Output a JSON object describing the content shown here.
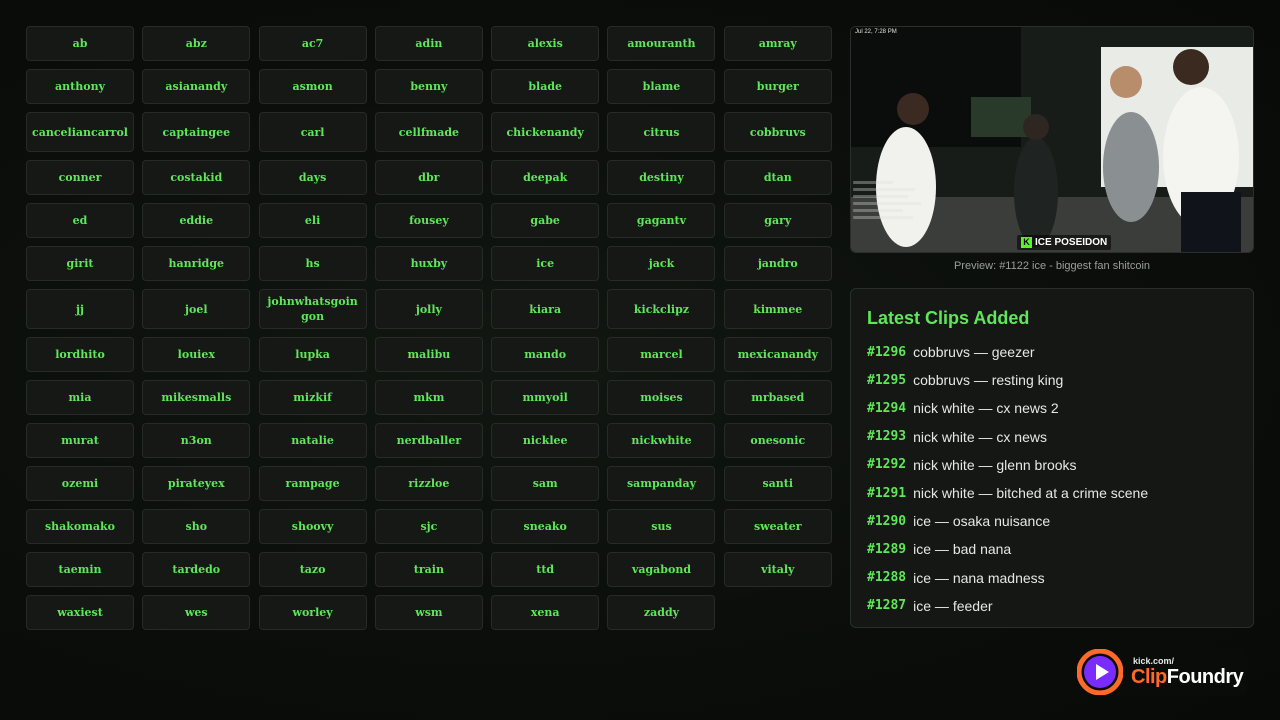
{
  "streamers": [
    "ab",
    "abz",
    "ac7",
    "adin",
    "alexis",
    "amouranth",
    "amray",
    "anthony",
    "asianandy",
    "asmon",
    "benny",
    "blade",
    "blame",
    "burger",
    "canceliancarrol",
    "captaingee",
    "carl",
    "cellfmade",
    "chickenandy",
    "citrus",
    "cobbruvs",
    "conner",
    "costakid",
    "days",
    "dbr",
    "deepak",
    "destiny",
    "dtan",
    "ed",
    "eddie",
    "eli",
    "fousey",
    "gabe",
    "gagantv",
    "gary",
    "girit",
    "hanridge",
    "hs",
    "huxby",
    "ice",
    "jack",
    "jandro",
    "jj",
    "joel",
    "johnwhatsgoingon",
    "jolly",
    "kiara",
    "kickclipz",
    "kimmee",
    "lordhito",
    "louiex",
    "lupka",
    "malibu",
    "mando",
    "marcel",
    "mexicanandy",
    "mia",
    "mikesmalls",
    "mizkif",
    "mkm",
    "mmyoil",
    "moises",
    "mrbased",
    "murat",
    "n3on",
    "natalie",
    "nerdballer",
    "nicklee",
    "nickwhite",
    "onesonic",
    "ozemi",
    "pirateyex",
    "rampage",
    "rizzloe",
    "sam",
    "sampanday",
    "santi",
    "shakomako",
    "sho",
    "shoovy",
    "sjc",
    "sneako",
    "sus",
    "sweater",
    "taemin",
    "tardedo",
    "tazo",
    "train",
    "ttd",
    "vagabond",
    "vitaly",
    "waxiest",
    "wes",
    "worley",
    "wsm",
    "xena",
    "zaddy"
  ],
  "preview": {
    "caption": "Preview: #1122 ice - biggest fan shitcoin",
    "timestamp": "Jul 22, 7:28 PM",
    "watermark_letter": "K",
    "watermark": "ICE POSEIDON"
  },
  "latest": {
    "title": "Latest Clips Added",
    "clips": [
      {
        "num": "#1296",
        "text": "cobbruvs — geezer"
      },
      {
        "num": "#1295",
        "text": "cobbruvs — resting king"
      },
      {
        "num": "#1294",
        "text": "nick white — cx news 2"
      },
      {
        "num": "#1293",
        "text": "nick white — cx news"
      },
      {
        "num": "#1292",
        "text": "nick white — glenn brooks"
      },
      {
        "num": "#1291",
        "text": "nick white — bitched at a crime scene"
      },
      {
        "num": "#1290",
        "text": "ice — osaka nuisance"
      },
      {
        "num": "#1289",
        "text": "ice — bad nana"
      },
      {
        "num": "#1288",
        "text": "ice — nana madness"
      },
      {
        "num": "#1287",
        "text": "ice — feeder"
      }
    ]
  },
  "logo": {
    "small": "kick.com/",
    "clip": "Clip",
    "foundry": "Foundry"
  },
  "colors": {
    "accent": "#5fe65a",
    "brand_orange": "#ff6a2a",
    "brand_purple": "#7a2cff"
  }
}
